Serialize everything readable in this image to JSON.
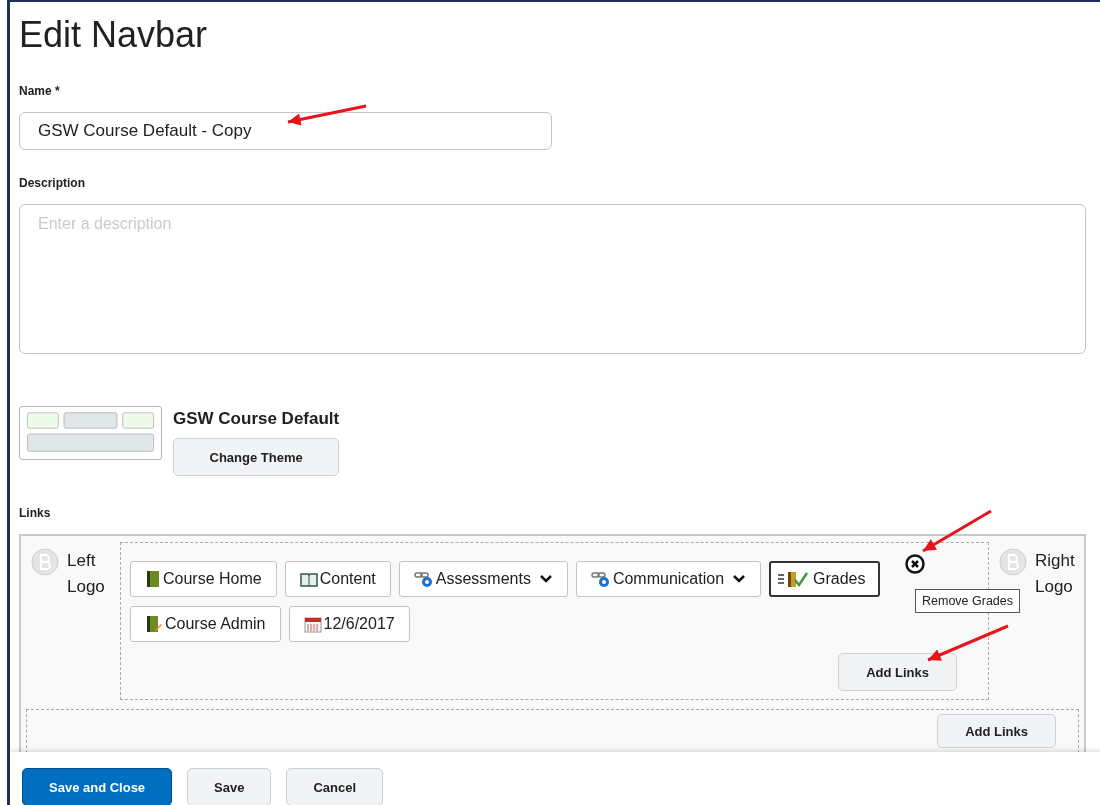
{
  "title": "Edit Navbar",
  "name_field": {
    "label": "Name *",
    "value": "GSW Course Default - Copy"
  },
  "description_field": {
    "label": "Description",
    "placeholder": "Enter a description"
  },
  "theme": {
    "name": "GSW Course Default",
    "button": "Change Theme"
  },
  "links": {
    "label": "Links",
    "left_logo": "Left\nLogo",
    "right_logo": "Right\nLogo",
    "items": [
      {
        "label": "Course Home",
        "kind": "book",
        "dropdown": false,
        "focused": false
      },
      {
        "label": "Content",
        "kind": "open-book",
        "dropdown": false,
        "focused": false
      },
      {
        "label": "Assessments",
        "kind": "links",
        "dropdown": true,
        "focused": false
      },
      {
        "label": "Communication",
        "kind": "links",
        "dropdown": true,
        "focused": false
      },
      {
        "label": "Grades",
        "kind": "grades",
        "dropdown": false,
        "focused": true,
        "tooltip": "Remove Grades"
      },
      {
        "label": "Course Admin",
        "kind": "book-edit",
        "dropdown": false,
        "focused": false
      },
      {
        "label": "12/6/2017",
        "kind": "calendar",
        "dropdown": false,
        "focused": false
      }
    ],
    "add_button": "Add Links",
    "second_add_button": "Add Links"
  },
  "footer": {
    "buttons": [
      {
        "label": "Save and Close",
        "primary": true
      },
      {
        "label": "Save",
        "primary": false
      },
      {
        "label": "Cancel",
        "primary": false
      }
    ]
  }
}
